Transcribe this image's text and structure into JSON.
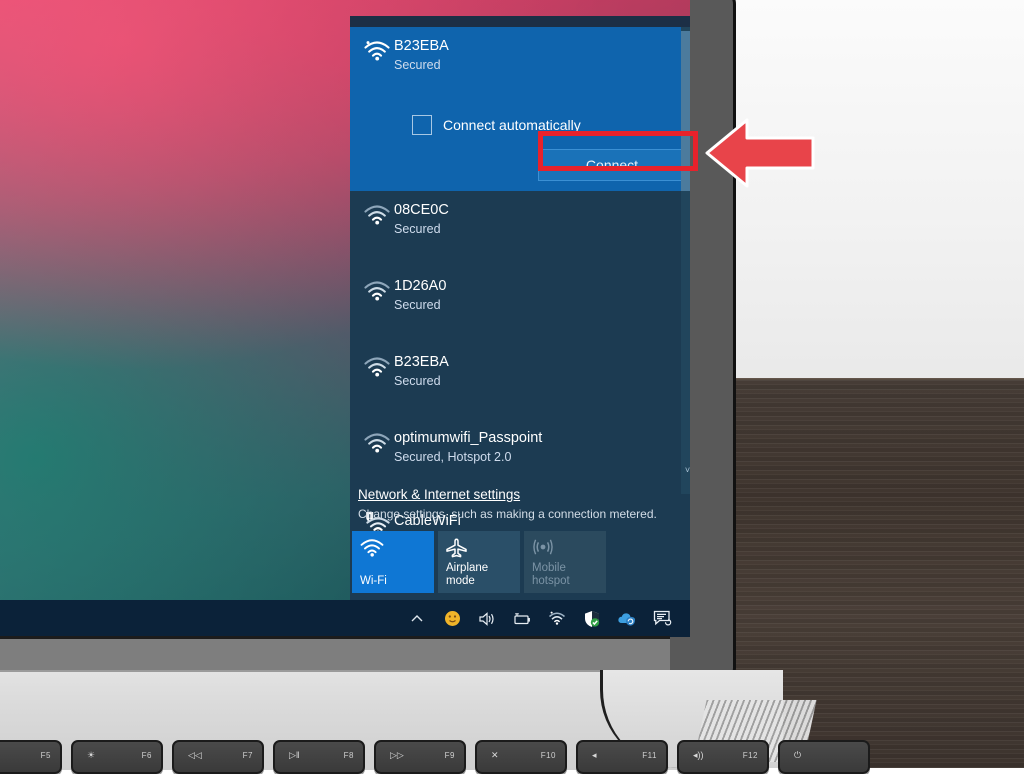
{
  "scene": {
    "description": "Windows 10 Wi-Fi network flyout on a laptop screen",
    "colors": {
      "accent_blue": "#0f64ad",
      "panel_bg": "#1c3b52",
      "taskbar": "#0b2239",
      "highlight_red": "#e8222b",
      "tile_on": "#0f77d4",
      "desk_wood": "#463c36"
    }
  },
  "flyout": {
    "selected_network": {
      "name": "B23EBA",
      "status": "Secured",
      "icon": "wifi-icon",
      "auto_connect_label": "Connect automatically",
      "auto_connect_checked": false,
      "connect_label": "Connect"
    },
    "networks": [
      {
        "name": "08CE0C",
        "status": "Secured",
        "icon": "wifi-icon",
        "warning": false
      },
      {
        "name": "1D26A0",
        "status": "Secured",
        "icon": "wifi-icon",
        "warning": false
      },
      {
        "name": "B23EBA",
        "status": "Secured",
        "icon": "wifi-icon",
        "warning": false
      },
      {
        "name": "optimumwifi_Passpoint",
        "status": "Secured, Hotspot 2.0",
        "icon": "wifi-icon",
        "warning": false
      },
      {
        "name": "CableWiFi",
        "status": "",
        "icon": "wifi-icon",
        "warning": true
      }
    ],
    "settings_link": "Network & Internet settings",
    "settings_sub": "Change settings, such as making a connection metered.",
    "tiles": [
      {
        "label": "Wi-Fi",
        "icon": "wifi-icon",
        "state": "on"
      },
      {
        "label": "Airplane mode",
        "icon": "airplane-icon",
        "state": "off"
      },
      {
        "label": "Mobile hotspot",
        "icon": "hotspot-icon",
        "state": "disabled"
      }
    ],
    "scrollbar": {
      "up": "˄",
      "down": "˅"
    }
  },
  "taskbar": {
    "tray_icons": [
      "chevron-up-icon",
      "status-circle-icon",
      "volume-icon",
      "battery-icon",
      "wifi-icon",
      "defender-shield-icon",
      "sync-cloud-icon",
      "action-center-icon"
    ]
  },
  "callout": {
    "arrow": "left-arrow-annotation",
    "color": "#e8444a"
  },
  "laptop": {
    "function_keys": [
      {
        "glyph": "☀",
        "label": "F5"
      },
      {
        "glyph": "☀",
        "label": "F6"
      },
      {
        "glyph": "◁◁",
        "label": "F7"
      },
      {
        "glyph": "▷‖",
        "label": "F8"
      },
      {
        "glyph": "▷▷",
        "label": "F9"
      },
      {
        "glyph": "✕",
        "label": "F10"
      },
      {
        "glyph": "◂",
        "label": "F11"
      },
      {
        "glyph": "◂))",
        "label": "F12"
      },
      {
        "glyph": "⏻",
        "label": ""
      }
    ]
  }
}
